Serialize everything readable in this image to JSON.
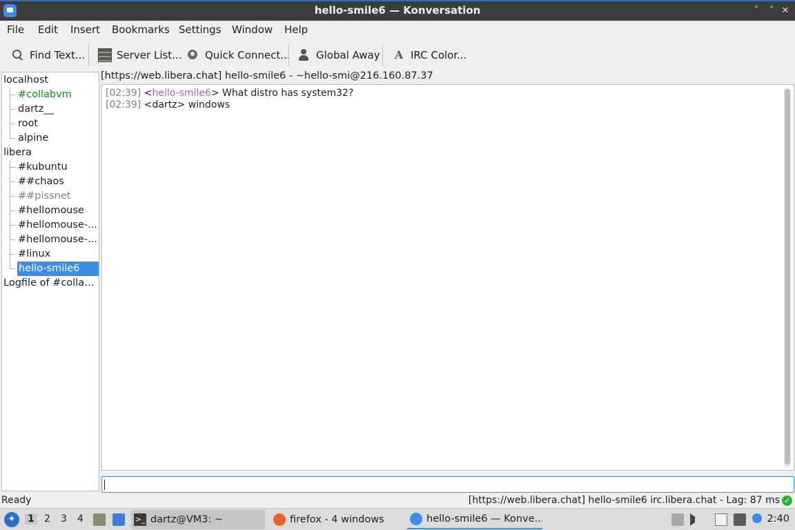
{
  "window": {
    "title": "hello-smile6 — Konversation",
    "minimize": "˅",
    "maximize": "˄",
    "close": "✕"
  },
  "menu": [
    "File",
    "Edit",
    "Insert",
    "Bookmarks",
    "Settings",
    "Window",
    "Help"
  ],
  "toolbar": {
    "find_text": "Find Text...",
    "server_list": "Server List...",
    "quick_connect": "Quick Connect...",
    "global_away": "Global Away",
    "irc_color": "IRC Color..."
  },
  "tree": {
    "localhost": "localhost",
    "localhost_children": [
      "#collabvm",
      "dartz__",
      "root",
      "alpine"
    ],
    "libera": "libera",
    "libera_children": [
      "#kubuntu",
      "##chaos",
      "##pissnet",
      "#hellomouse",
      "#hellomouse-...",
      "#hellomouse-...",
      "#linux",
      "hello-smile6"
    ],
    "logfile": "Logfile of #collab..."
  },
  "topic": "[https://web.libera.chat] hello-smile6 - ~hello-smi@216.160.87.37",
  "messages": [
    {
      "time": "[02:39]",
      "open": " <",
      "nick": "hello-smile6",
      "close": ">",
      "text": " What distro has system32?"
    },
    {
      "time": "[02:39]",
      "open": " <",
      "nick": "dartz",
      "close": ">",
      "text": " windows"
    }
  ],
  "input": {
    "value": ""
  },
  "status": {
    "left": "Ready",
    "right": "[https://web.libera.chat] hello-smile6  irc.libera.chat - Lag: 87 ms",
    "ok": "✓"
  },
  "taskbar": {
    "start": "✦",
    "workspaces": [
      "1",
      "2",
      "3",
      "4"
    ],
    "tasks": [
      "dartz@VM3: ~",
      "firefox - 4 windows",
      "hello-smile6 — Konve..."
    ],
    "clock": "2:40"
  },
  "colors": {
    "accent": "#3b8de6",
    "channel_green": "#148a14",
    "nick_purple": "#a462c7",
    "titlebar": "#3c3c3c"
  }
}
